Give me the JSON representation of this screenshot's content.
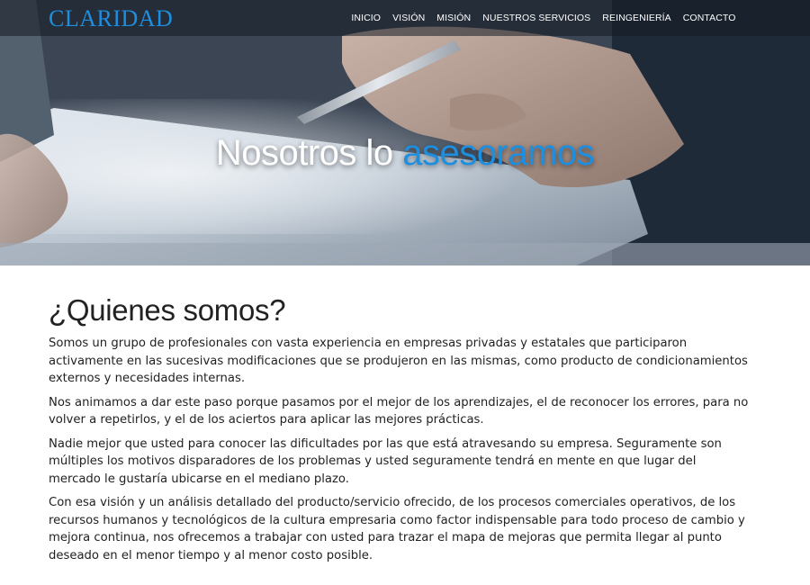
{
  "brand": "CLARIDAD",
  "nav": {
    "items": [
      {
        "label": "INICIO"
      },
      {
        "label": "VISIÓN"
      },
      {
        "label": "MISIÓN"
      },
      {
        "label": "NUESTROS SERVICIOS"
      },
      {
        "label": "REINGENIERÍA"
      },
      {
        "label": "CONTACTO"
      }
    ]
  },
  "hero": {
    "title_plain": "Nosotros lo ",
    "title_accent": "asesoramos"
  },
  "about": {
    "heading": "¿Quienes somos?",
    "paragraphs": [
      "Somos un grupo de profesionales con vasta experiencia en empresas privadas y estatales que participaron activamente en las sucesivas modificaciones que se produjeron en las mismas, como producto de condicionamientos externos y necesidades internas.",
      "Nos animamos a dar este paso porque pasamos por el mejor de los aprendizajes, el de reconocer los errores, para no volver a repetirlos, y el de los aciertos para aplicar las mejores prácticas.",
      "Nadie mejor que usted para conocer las dificultades por las que está atravesando su empresa. Seguramente son múltiples los motivos disparadores de los problemas y usted seguramente tendrá en mente en que lugar del mercado le gustaría ubicarse en el mediano plazo.",
      "Con esa visión y un análisis detallado del producto/servicio ofrecido, de los procesos comerciales operativos, de los recursos humanos y tecnológicos de la cultura empresaria como factor indispensable para todo proceso de cambio y mejora continua, nos ofrecemos a trabajar con usted para trazar el mapa de mejoras que permita llegar al punto deseado en el menor tiempo y al menor costo posible."
    ]
  },
  "colors": {
    "accent": "#1d8fe0",
    "text": "#222222"
  }
}
